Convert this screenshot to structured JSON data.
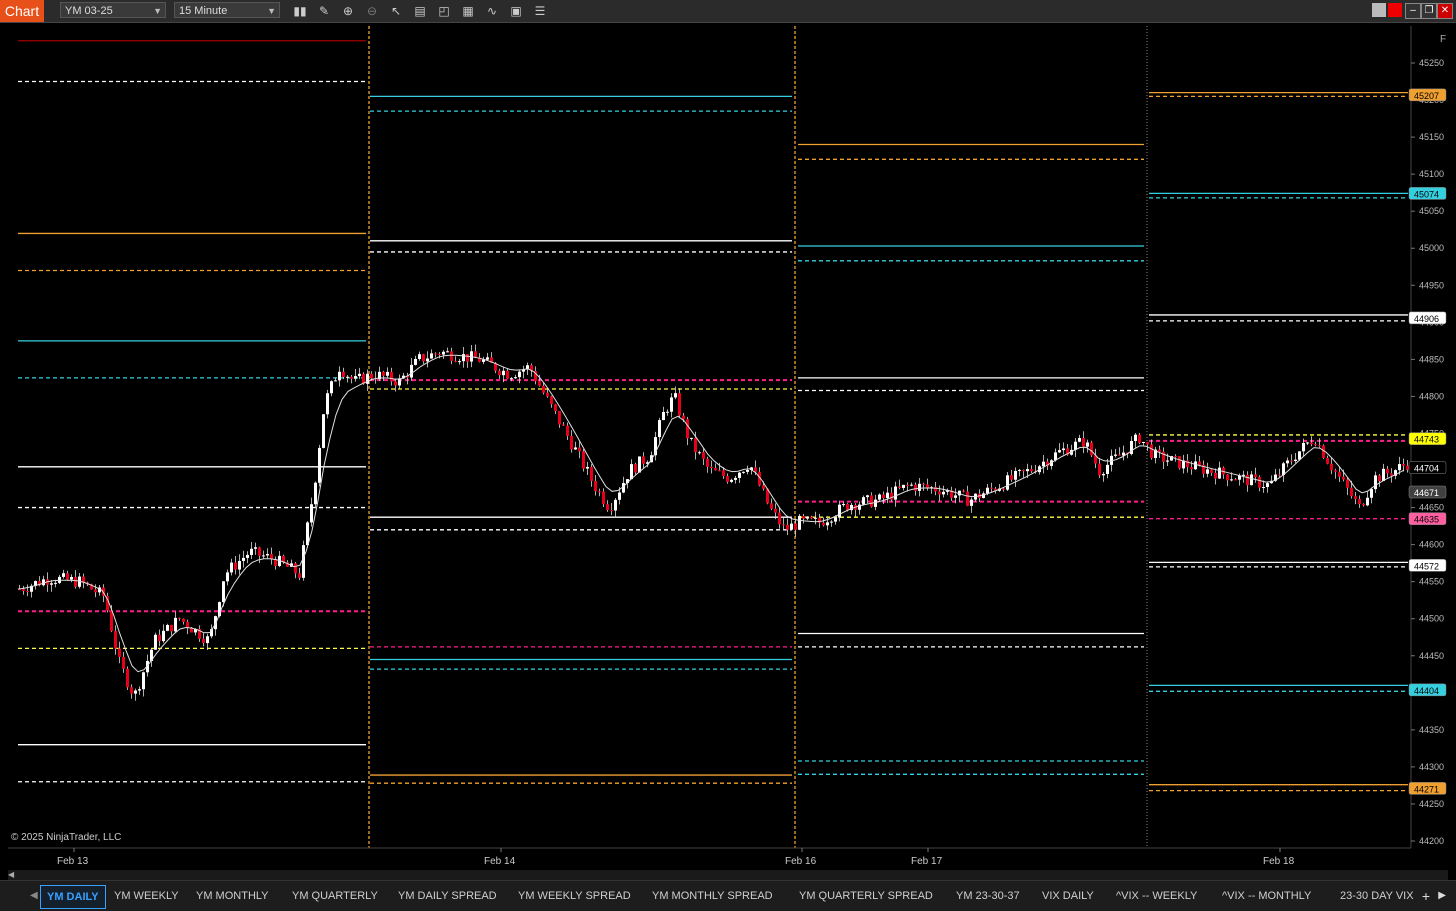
{
  "toolbar": {
    "title": "Chart",
    "instrument": "YM 03-25",
    "interval": "15 Minute",
    "icons": [
      "bar-chart-icon",
      "pencil-icon",
      "zoom-in-icon",
      "zoom-out-icon",
      "pointer-icon",
      "data-box-icon",
      "properties-icon",
      "strategies-icon",
      "indicators-icon",
      "template-icon",
      "list-icon"
    ],
    "window_buttons": [
      "tile-icon",
      "close-link-icon",
      "minimize-icon",
      "restore-icon",
      "close-icon"
    ]
  },
  "chart": {
    "copyright": "© 2025 NinjaTrader, LLC",
    "corner_label": "F",
    "x_labels": [
      {
        "text": "Feb 13"
      },
      {
        "text": "Feb 14"
      },
      {
        "text": "Feb 16"
      },
      {
        "text": "Feb 17"
      },
      {
        "text": "Feb 18"
      }
    ],
    "y_ticks": [
      45250,
      45200,
      45150,
      45100,
      45050,
      45000,
      44950,
      44900,
      44850,
      44800,
      44750,
      44700,
      44650,
      44600,
      44550,
      44500,
      44450,
      44400,
      44350,
      44300,
      44250,
      44200
    ],
    "price_tags": [
      {
        "value": "45207",
        "color": "#f0a030",
        "text_color": "#000"
      },
      {
        "value": "45074",
        "color": "#35d0e0",
        "text_color": "#000"
      },
      {
        "value": "44906",
        "color": "#ffffff",
        "text_color": "#000"
      },
      {
        "value": "44743",
        "color": "#ffff00",
        "text_color": "#000"
      },
      {
        "value": "44704",
        "color": "#000000",
        "text_color": "#fff"
      },
      {
        "value": "44671",
        "color": "#404040",
        "text_color": "#fff"
      },
      {
        "value": "44635",
        "color": "#ff5fa0",
        "text_color": "#000"
      },
      {
        "value": "44572",
        "color": "#ffffff",
        "text_color": "#000"
      },
      {
        "value": "44404",
        "color": "#35d0e0",
        "text_color": "#000"
      },
      {
        "value": "44271",
        "color": "#f0a030",
        "text_color": "#000"
      }
    ],
    "colors": {
      "up": "#ffffff",
      "down": "#e8001a",
      "orange": "#f0a030",
      "cyan": "#35d0e0",
      "magenta": "#ff1e8c",
      "yellow": "#ffff40",
      "darkred": "#a00000",
      "white": "#ffffff"
    }
  },
  "tabs": [
    {
      "label": "YM DAILY",
      "active": true
    },
    {
      "label": "YM WEEKLY"
    },
    {
      "label": "YM MONTHLY"
    },
    {
      "label": "YM QUARTERLY"
    },
    {
      "label": "YM DAILY SPREAD"
    },
    {
      "label": "YM WEEKLY SPREAD"
    },
    {
      "label": "YM MONTHLY SPREAD"
    },
    {
      "label": "YM QUARTERLY SPREAD"
    },
    {
      "label": "YM 23-30-37"
    },
    {
      "label": "VIX DAILY"
    },
    {
      "label": "^VIX -- WEEKLY"
    },
    {
      "label": "^VIX -- MONTHLY"
    },
    {
      "label": "23-30 DAY VIX"
    }
  ]
}
